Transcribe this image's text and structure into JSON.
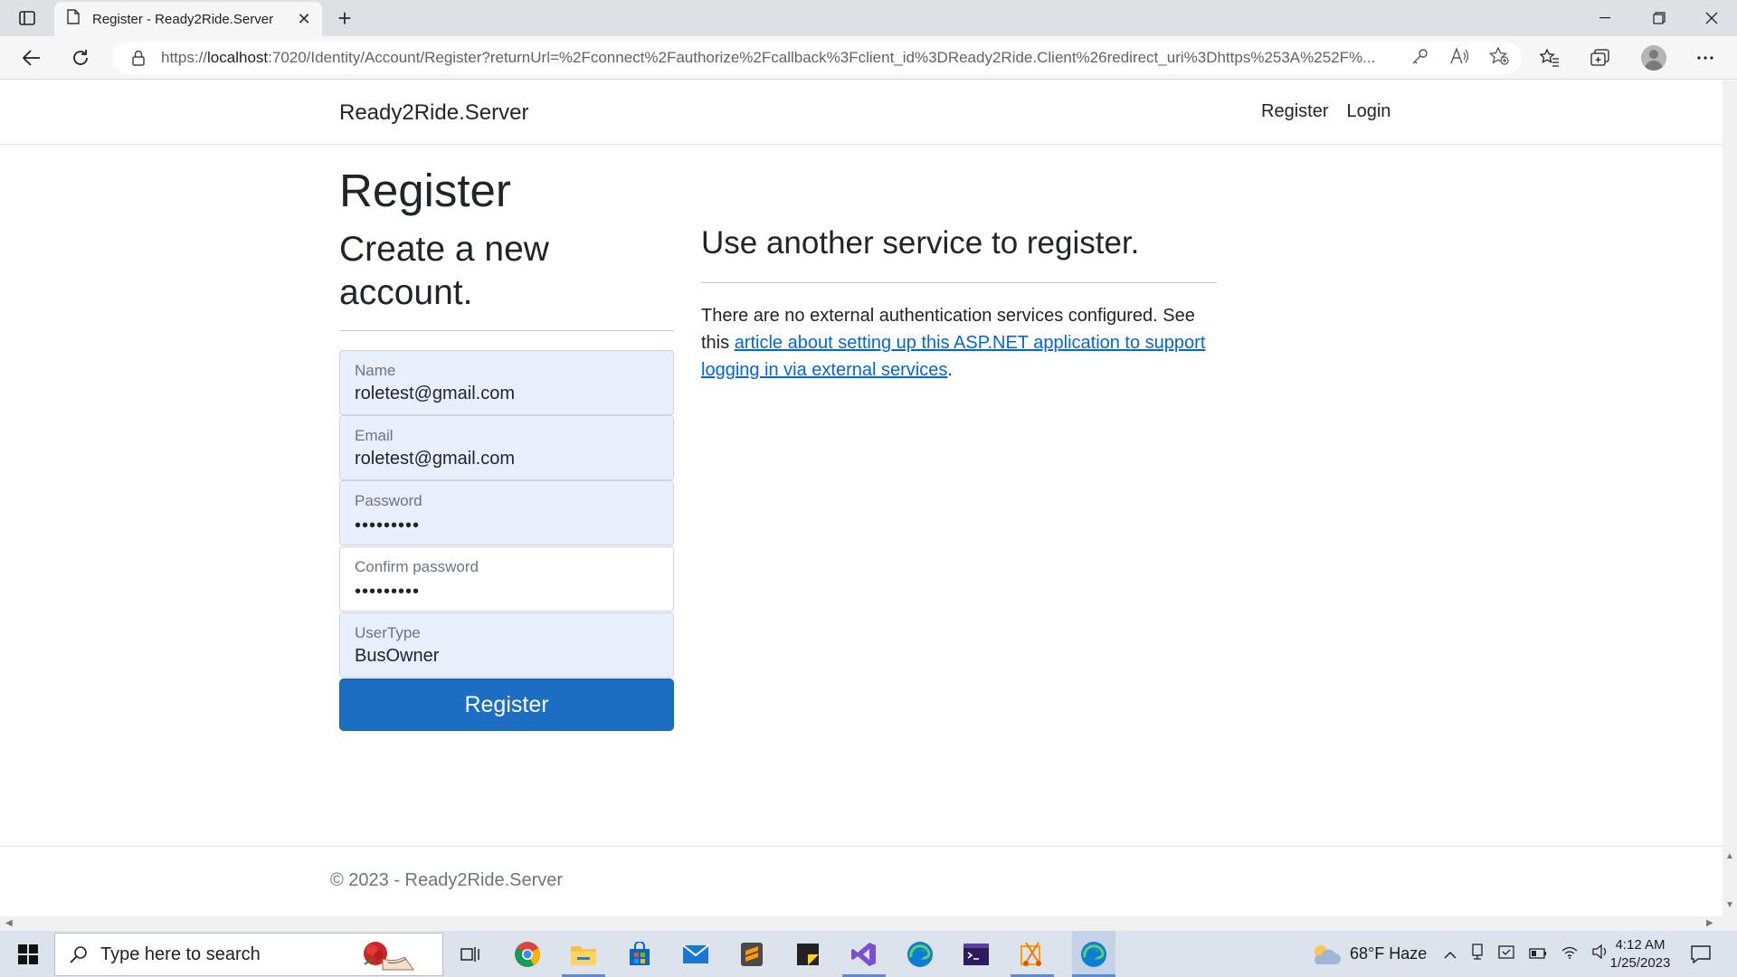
{
  "browser": {
    "tab_title": "Register - Ready2Ride.Server",
    "url_prefix": "https://",
    "url_host": "localhost",
    "url_rest": ":7020/Identity/Account/Register?returnUrl=%2Fconnect%2Fauthorize%2Fcallback%3Fclient_id%3DReady2Ride.Client%26redirect_uri%3Dhttps%253A%252F%..."
  },
  "nav": {
    "brand": "Ready2Ride.Server",
    "links": [
      "Register",
      "Login"
    ]
  },
  "form": {
    "title": "Register",
    "subtitle": "Create a new account.",
    "fields": [
      {
        "label": "Name",
        "value": "roletest@gmail.com"
      },
      {
        "label": "Email",
        "value": "roletest@gmail.com"
      },
      {
        "label": "Password",
        "value": "•••••••••"
      },
      {
        "label": "Confirm password",
        "value": "•••••••••"
      },
      {
        "label": "UserType",
        "value": "BusOwner"
      }
    ],
    "submit_label": "Register"
  },
  "external": {
    "heading": "Use another service to register.",
    "text_before": "There are no external authentication services configured. See this ",
    "link_text": "article about setting up this ASP.NET application to support logging in via external services",
    "text_after": "."
  },
  "footer": {
    "text": "© 2023 - Ready2Ride.Server"
  },
  "taskbar": {
    "search_placeholder": "Type here to search",
    "weather": "68°F  Haze",
    "time": "4:12 AM",
    "date": "1/25/2023"
  },
  "colors": {
    "primary_button": "#1b6ec2",
    "link": "#0366d6",
    "autofill_bg": "#e8f0fe"
  }
}
